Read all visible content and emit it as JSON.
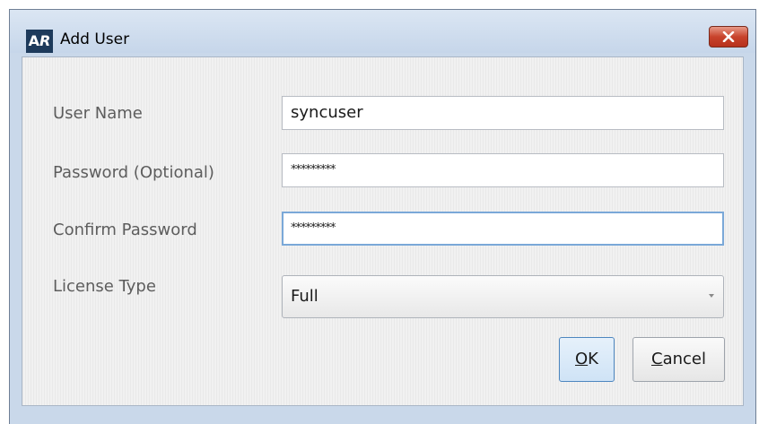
{
  "window": {
    "app_icon_text_a": "A",
    "app_icon_text_r": "R",
    "title": "Add User"
  },
  "fields": {
    "user_name": {
      "label": "User Name",
      "value": "syncuser"
    },
    "password": {
      "label": "Password (Optional)",
      "value": "*********"
    },
    "confirm_password": {
      "label": "Confirm Password",
      "value": "*********"
    },
    "license_type": {
      "label": "License Type",
      "selected": "Full"
    }
  },
  "buttons": {
    "ok": {
      "mnemonic": "O",
      "rest": "K"
    },
    "cancel": {
      "mnemonic": "C",
      "rest": "ancel"
    }
  },
  "icons": {
    "close": "close-x-icon",
    "dropdown": "chevron-down-icon"
  },
  "colors": {
    "title_bar": "#c6d6ea",
    "close_button": "#c8432c",
    "app_icon_bg": "#1d3a5b",
    "focus_border": "#7aa8d8",
    "default_button_border": "#4d86bf"
  }
}
